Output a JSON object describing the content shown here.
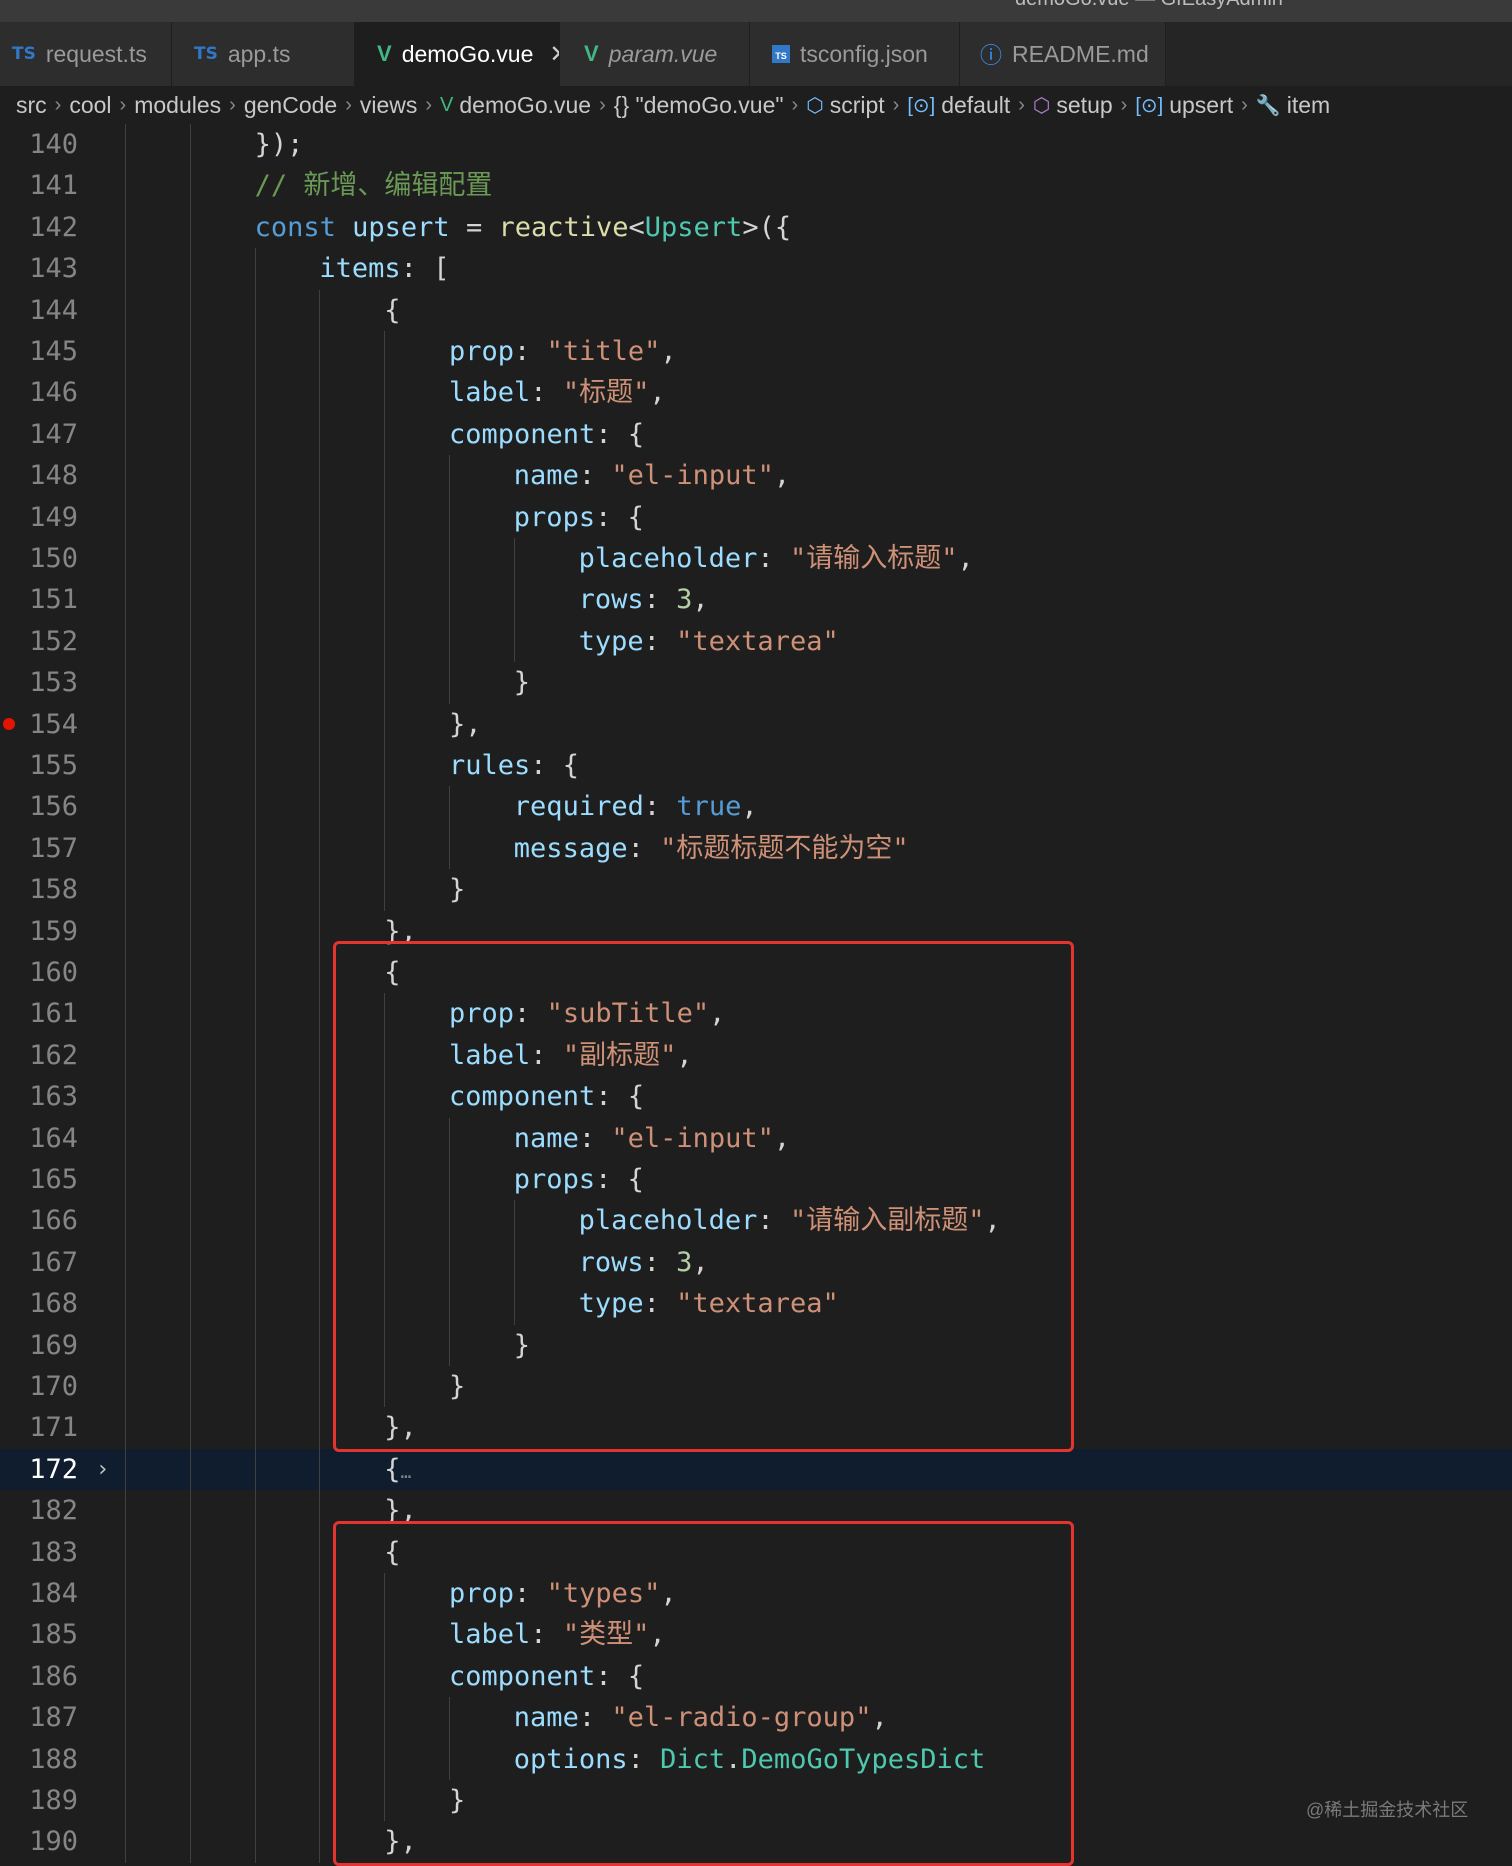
{
  "window": {
    "title": "demoGo.vue — GfEasyAdmin"
  },
  "tabs": [
    {
      "label": "request.ts",
      "icon": "ts-icon",
      "active": false
    },
    {
      "label": "app.ts",
      "icon": "ts-icon",
      "active": false
    },
    {
      "label": "demoGo.vue",
      "icon": "vue-icon",
      "active": true
    },
    {
      "label": "param.vue",
      "icon": "vue-icon",
      "active": false
    },
    {
      "label": "tsconfig.json",
      "icon": "tsconfig-icon",
      "active": false
    },
    {
      "label": "README.md",
      "icon": "info-icon",
      "active": false
    }
  ],
  "breadcrumb": [
    "src",
    "cool",
    "modules",
    "genCode",
    "views",
    "demoGo.vue",
    "{} \"demoGo.vue\"",
    "script",
    "default",
    "setup",
    "upsert",
    "item"
  ],
  "editor": {
    "current_line": "172",
    "breakpoint_line": "154",
    "highlight_color": "#e3342f",
    "lines": [
      {
        "n": "140",
        "code": "});"
      },
      {
        "n": "141",
        "code": "// 新增、编辑配置"
      },
      {
        "n": "142",
        "code": "const upsert = reactive<Upsert>({"
      },
      {
        "n": "143",
        "code": "items: ["
      },
      {
        "n": "144",
        "code": "{"
      },
      {
        "n": "145",
        "code": "prop: \"title\","
      },
      {
        "n": "146",
        "code": "label: \"标题\","
      },
      {
        "n": "147",
        "code": "component: {"
      },
      {
        "n": "148",
        "code": "name: \"el-input\","
      },
      {
        "n": "149",
        "code": "props: {"
      },
      {
        "n": "150",
        "code": "placeholder: \"请输入标题\","
      },
      {
        "n": "151",
        "code": "rows: 3,"
      },
      {
        "n": "152",
        "code": "type: \"textarea\""
      },
      {
        "n": "153",
        "code": "}"
      },
      {
        "n": "154",
        "code": "},"
      },
      {
        "n": "155",
        "code": "rules: {"
      },
      {
        "n": "156",
        "code": "required: true,"
      },
      {
        "n": "157",
        "code": "message: \"标题标题不能为空\""
      },
      {
        "n": "158",
        "code": "}"
      },
      {
        "n": "159",
        "code": "},"
      },
      {
        "n": "160",
        "code": "{"
      },
      {
        "n": "161",
        "code": "prop: \"subTitle\","
      },
      {
        "n": "162",
        "code": "label: \"副标题\","
      },
      {
        "n": "163",
        "code": "component: {"
      },
      {
        "n": "164",
        "code": "name: \"el-input\","
      },
      {
        "n": "165",
        "code": "props: {"
      },
      {
        "n": "166",
        "code": "placeholder: \"请输入副标题\","
      },
      {
        "n": "167",
        "code": "rows: 3,"
      },
      {
        "n": "168",
        "code": "type: \"textarea\""
      },
      {
        "n": "169",
        "code": "}"
      },
      {
        "n": "170",
        "code": "}"
      },
      {
        "n": "171",
        "code": "},"
      },
      {
        "n": "172",
        "code": "{…"
      },
      {
        "n": "182",
        "code": "},"
      },
      {
        "n": "183",
        "code": "{"
      },
      {
        "n": "184",
        "code": "prop: \"types\","
      },
      {
        "n": "185",
        "code": "label: \"类型\","
      },
      {
        "n": "186",
        "code": "component: {"
      },
      {
        "n": "187",
        "code": "name: \"el-radio-group\","
      },
      {
        "n": "188",
        "code": "options: Dict.DemoGoTypesDict"
      },
      {
        "n": "189",
        "code": "}"
      },
      {
        "n": "190",
        "code": "},"
      }
    ]
  },
  "watermark": "@稀土掘金技术社区"
}
